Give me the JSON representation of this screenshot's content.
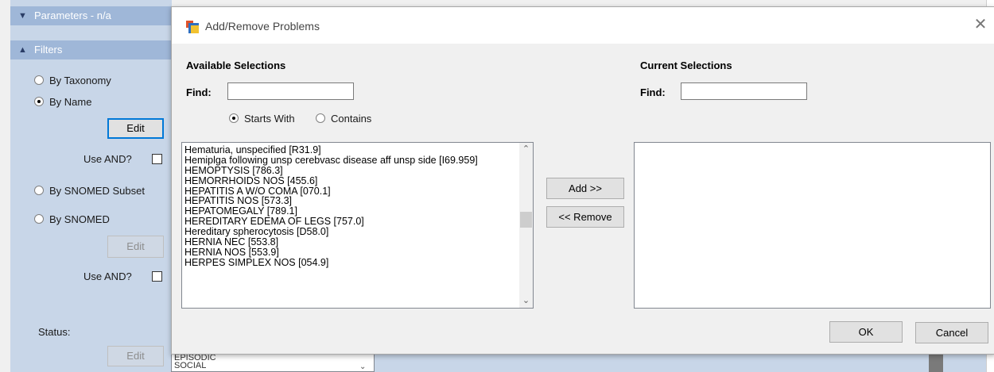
{
  "left_panel": {
    "parameters_header": "Parameters - n/a",
    "filters_header": "Filters",
    "radio_by_taxonomy": "By Taxonomy",
    "radio_by_name": "By Name",
    "edit_label": "Edit",
    "use_and_label": "Use AND?",
    "radio_by_snomed_subset": "By SNOMED Subset",
    "radio_by_snomed": "By SNOMED",
    "status_label": "Status:"
  },
  "dialog": {
    "title": "Add/Remove Problems",
    "close_icon": "close-icon",
    "available_title": "Available Selections",
    "current_title": "Current Selections",
    "find_label": "Find:",
    "find_available_value": "",
    "find_current_value": "",
    "starts_with_label": "Starts With",
    "contains_label": "Contains",
    "search_mode_selected": "Starts With",
    "available_items": [
      "Hematuria, unspecified [R31.9]",
      "Hemiplga following unsp cerebvasc disease aff unsp side [I69.959]",
      "HEMOPTYSIS [786.3]",
      "HEMORRHOIDS NOS [455.6]",
      "HEPATITIS A W/O COMA [070.1]",
      "HEPATITIS NOS [573.3]",
      "HEPATOMEGALY [789.1]",
      "HEREDITARY EDEMA OF LEGS [757.0]",
      "Hereditary spherocytosis [D58.0]",
      "HERNIA NEC [553.8]",
      "HERNIA NOS [553.9]",
      "HERPES SIMPLEX NOS [054.9]"
    ],
    "current_items": [],
    "add_button": "Add >>",
    "remove_button": "<< Remove",
    "ok_button": "OK",
    "cancel_button": "Cancel"
  },
  "background_list": {
    "items": [
      "EPISODIC",
      "SOCIAL"
    ]
  },
  "colors": {
    "panel_bg": "#c8d6e8",
    "panel_header": "#9fb7d8",
    "focus_border": "#0078d7"
  }
}
